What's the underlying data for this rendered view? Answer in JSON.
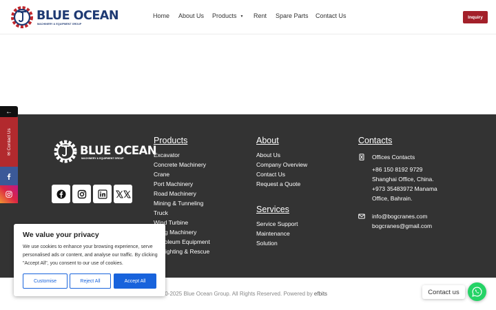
{
  "brand": {
    "name": "BLUE OCEAN",
    "tagline": "MACHINERY & EQUIPMENT GROUP",
    "primary_color": "#1f3a73",
    "accent_color": "#a3202a"
  },
  "nav": {
    "items": [
      {
        "label": "Home"
      },
      {
        "label": "About Us"
      },
      {
        "label": "Products",
        "has_caret": true
      },
      {
        "label": "Rent"
      },
      {
        "label": "Spare Parts"
      },
      {
        "label": "Contact Us"
      }
    ],
    "inquiry_label": "Inquiry"
  },
  "footer": {
    "background": "#333333",
    "socials": [
      "facebook-icon",
      "instagram-icon",
      "linkedin-icon",
      "x-twitter-icon"
    ],
    "products": {
      "title": "Products",
      "items": [
        "Excavator",
        "Concrete Machinery",
        "Crane",
        "Port Machinery",
        "Road Machinery",
        "Mining & Tunneling",
        "Truck",
        "Wind Turbine",
        "Piling Machinery",
        "Petroleum Equipment",
        "Firefighting & Rescue"
      ]
    },
    "about": {
      "title": "About",
      "items": [
        "About Us",
        "Company Overview",
        "Contact Us",
        "Request a Quote"
      ]
    },
    "services": {
      "title": "Services",
      "items": [
        "Service Support",
        "Maintenance",
        "Solution"
      ]
    },
    "contacts": {
      "title": "Contacts",
      "offices_label": "Offices Contacts",
      "lines": [
        "+86 150 8192 9729",
        "Shanghai Office, China.",
        "+973 35483972 Manama",
        "Office, Bahrain."
      ],
      "emails": [
        "info@bogcranes.com",
        "bogcranes@gmail.com"
      ]
    }
  },
  "copyright": {
    "text": "2000-2025 Blue Ocean Group. All Rights Reserved. Powered by ",
    "link": "efbits"
  },
  "side_bar": {
    "toggle": "←",
    "contact_label": "Contact Us"
  },
  "cookie": {
    "title": "We value your privacy",
    "text": "We use cookies to enhance your browsing experience, serve personalised ads or content, and analyse our traffic. By clicking \"Accept All\", you consent to our use of cookies.",
    "customise": "Customise",
    "reject": "Reject All",
    "accept": "Accept All",
    "accent_color": "#1863dc"
  },
  "chat_widget": {
    "label": "Contact us",
    "color": "#25d366"
  }
}
